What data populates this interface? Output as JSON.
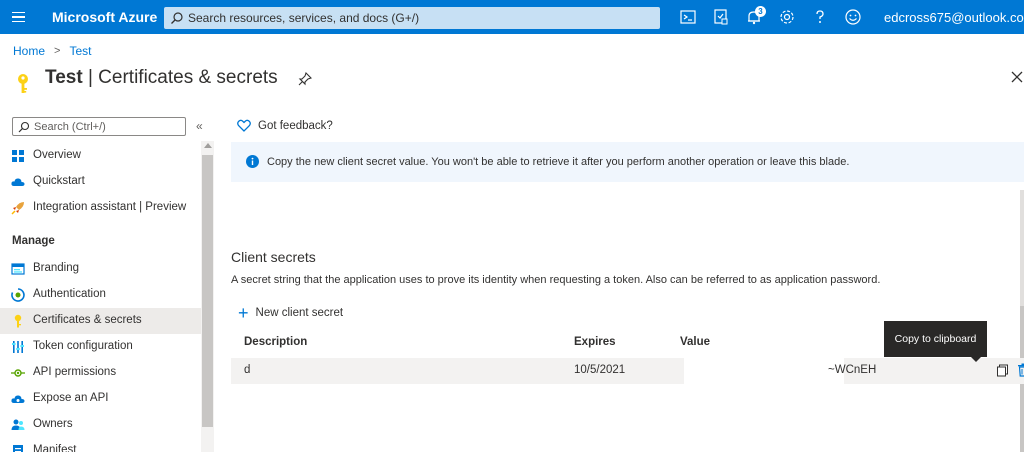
{
  "topbar": {
    "brand": "Microsoft Azure",
    "search_placeholder": "Search resources, services, and docs (G+/)",
    "notification_count": "3",
    "account": "edcross675@outlook.co..."
  },
  "breadcrumb": {
    "home": "Home",
    "current": "Test"
  },
  "header": {
    "resource": "Test",
    "separator": "|",
    "page": "Certificates & secrets"
  },
  "sidebar": {
    "search_placeholder": "Search (Ctrl+/)",
    "collapse": "«",
    "top_items": [
      {
        "label": "Overview",
        "icon": "grid-icon"
      },
      {
        "label": "Quickstart",
        "icon": "cloud-icon"
      },
      {
        "label": "Integration assistant | Preview",
        "icon": "rocket-icon"
      }
    ],
    "section": "Manage",
    "manage_items": [
      {
        "label": "Branding",
        "icon": "branding-icon"
      },
      {
        "label": "Authentication",
        "icon": "authentication-icon"
      },
      {
        "label": "Certificates & secrets",
        "icon": "key-icon",
        "active": true
      },
      {
        "label": "Token configuration",
        "icon": "token-icon"
      },
      {
        "label": "API permissions",
        "icon": "permissions-icon"
      },
      {
        "label": "Expose an API",
        "icon": "cloud-api-icon"
      },
      {
        "label": "Owners",
        "icon": "owners-icon"
      },
      {
        "label": "Manifest",
        "icon": "manifest-icon"
      }
    ]
  },
  "main": {
    "feedback": "Got feedback?",
    "info": "Copy the new client secret value. You won't be able to retrieve it after you perform another operation or leave this blade.",
    "section_title": "Client secrets",
    "section_desc": "A secret string that the application uses to prove its identity when requesting a token. Also can be referred to as application password.",
    "new_secret": "New client secret",
    "columns": {
      "description": "Description",
      "expires": "Expires",
      "value": "Value"
    },
    "rows": [
      {
        "description": "d",
        "expires": "10/5/2021",
        "value_suffix": "~WCnEH"
      }
    ],
    "tooltip": "Copy to clipboard"
  },
  "colors": {
    "accent": "#0078d4",
    "key": "#fcd116",
    "delete": "#0078d4"
  }
}
